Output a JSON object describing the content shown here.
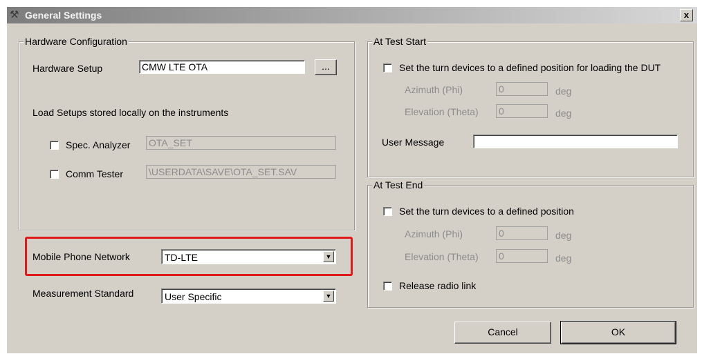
{
  "window": {
    "title": "General Settings",
    "title_icon": "tools-icon",
    "close_label": "x"
  },
  "hardware": {
    "legend": "Hardware Configuration",
    "setup_label": "Hardware Setup",
    "setup_value": "CMW LTE OTA",
    "browse_label": "...",
    "load_text": "Load Setups stored locally on the instruments",
    "spec_analyzer_label": "Spec. Analyzer",
    "spec_analyzer_value": "OTA_SET",
    "comm_tester_label": "Comm Tester",
    "comm_tester_value": "\\USERDATA\\SAVE\\OTA_SET.SAV"
  },
  "network": {
    "label": "Mobile Phone Network",
    "value": "TD-LTE"
  },
  "standard": {
    "label": "Measurement Standard",
    "value": "User Specific"
  },
  "test_start": {
    "legend": "At Test Start",
    "turn_label": "Set the turn devices to a defined position for loading the DUT",
    "azimuth_label": "Azimuth (Phi)",
    "azimuth_value": "0",
    "azimuth_unit": "deg",
    "elevation_label": "Elevation (Theta)",
    "elevation_value": "0",
    "elevation_unit": "deg",
    "user_message_label": "User Message",
    "user_message_value": ""
  },
  "test_end": {
    "legend": "At Test End",
    "turn_label": "Set the turn devices to a defined position",
    "azimuth_label": "Azimuth (Phi)",
    "azimuth_value": "0",
    "azimuth_unit": "deg",
    "elevation_label": "Elevation (Theta)",
    "elevation_value": "0",
    "elevation_unit": "deg",
    "release_label": "Release radio link"
  },
  "buttons": {
    "cancel": "Cancel",
    "ok": "OK"
  },
  "colors": {
    "highlight": "#e0191b",
    "dialog_bg": "#d4d0c8"
  }
}
